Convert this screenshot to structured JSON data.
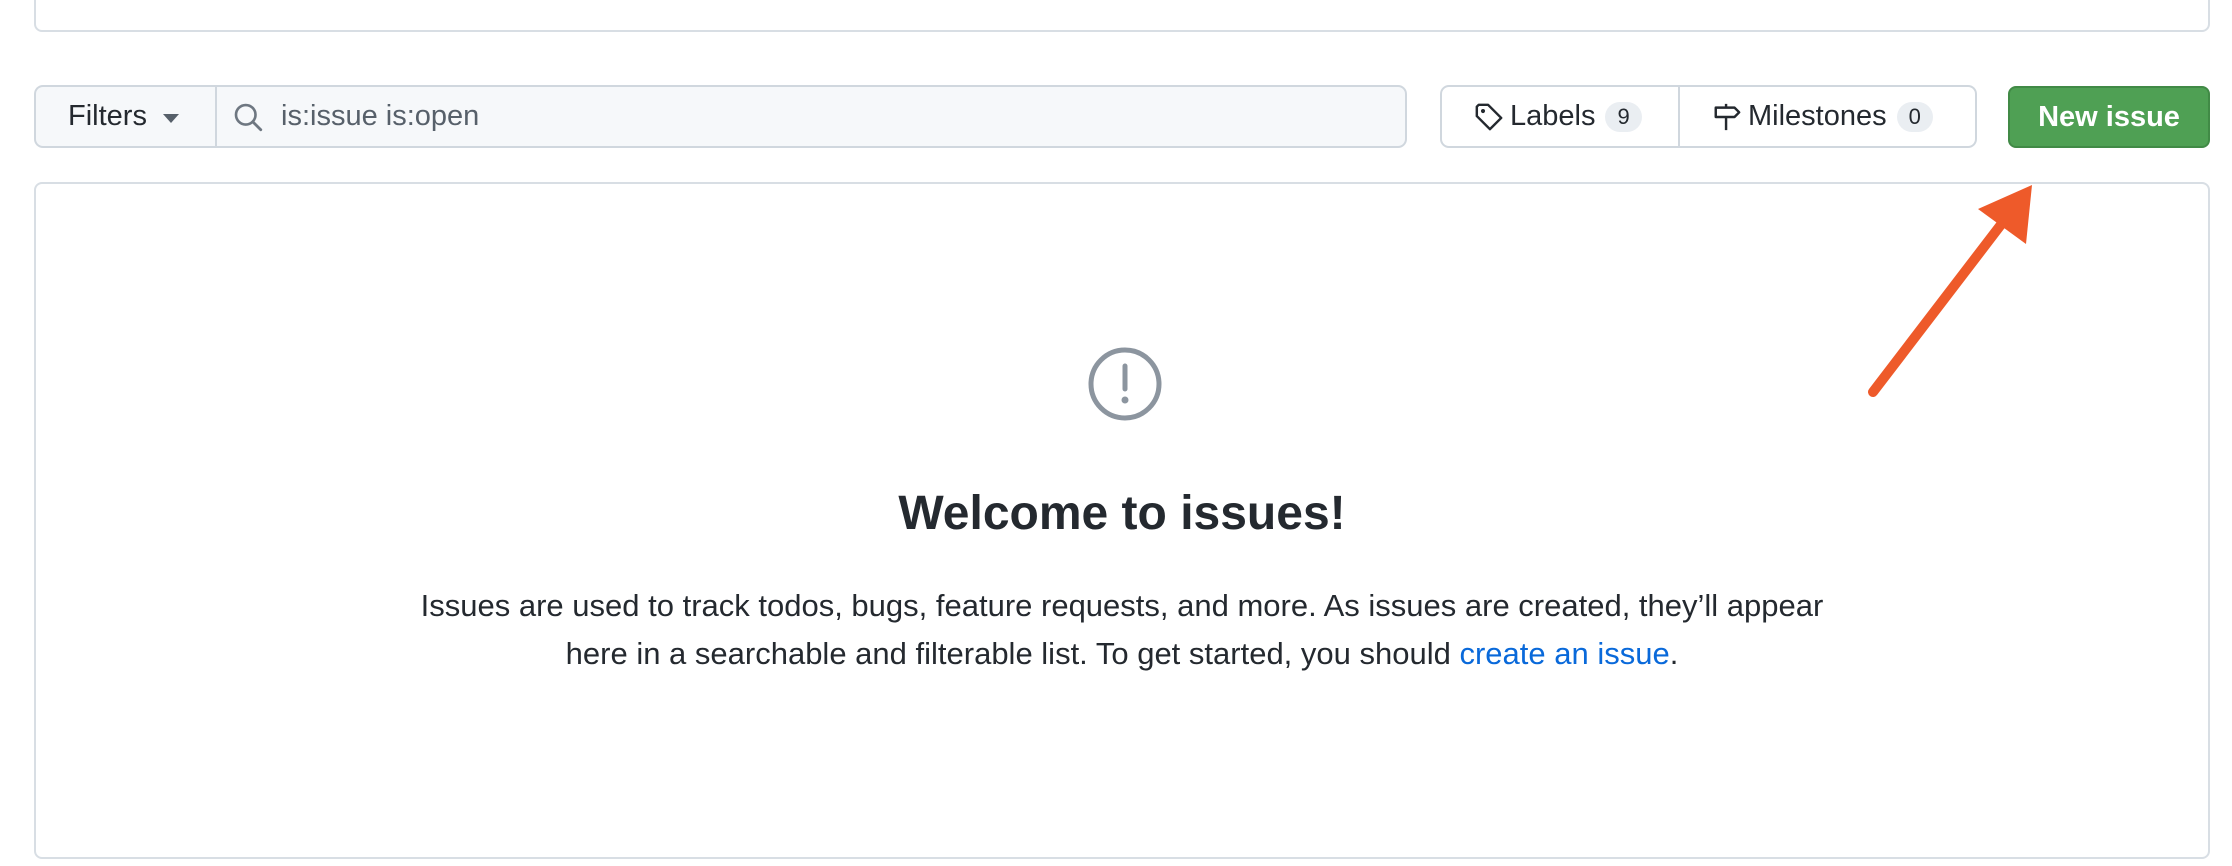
{
  "filters": {
    "label": "Filters",
    "search_value": "is:issue is:open"
  },
  "labels": {
    "label": "Labels",
    "count": "9"
  },
  "milestones": {
    "label": "Milestones",
    "count": "0"
  },
  "new_issue": {
    "label": "New issue",
    "color": "#4fa054"
  },
  "blankslate": {
    "icon": "issue-opened-icon",
    "title": "Welcome to issues!",
    "description_line1": "Issues are used to track todos, bugs, feature requests, and more. As issues are created, they’ll appear",
    "description_line2_prefix": "here in a searchable and filterable list. To get started, you should ",
    "link_text": "create an issue",
    "description_line2_suffix": "."
  },
  "annotation": {
    "icon": "arrow-annotation",
    "color": "#ee5a2a"
  }
}
